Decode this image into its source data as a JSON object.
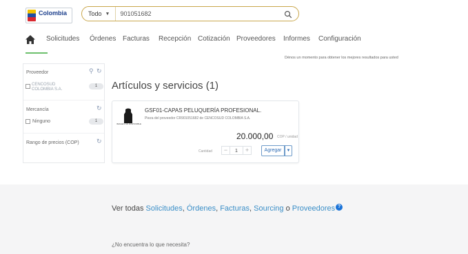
{
  "header": {
    "logo_text": "Colombia",
    "search_scope": "Todo",
    "search_value": "901051682"
  },
  "nav": {
    "items": [
      "Solicitudes",
      "Órdenes",
      "Facturas",
      "Recepción",
      "Cotización",
      "Proveedores",
      "Informes",
      "Configuración"
    ]
  },
  "status_message": "Dénos un momento para obtener los mejores resultados para usted",
  "filters": {
    "supplier": {
      "label": "Proveedor",
      "option": "CENCOSUD COLOMBIA S.A.",
      "count": "1"
    },
    "merchandise": {
      "label": "Mercancía",
      "option": "Ninguno",
      "count": "1"
    },
    "price_range": {
      "label": "Rango de precios (COP)"
    }
  },
  "results": {
    "title": "Artículos y servicios (1)",
    "item": {
      "thumbnail_caption": "IMAGEN NO DISPONIBLE",
      "title": "GSF01-CAPAS PELUQUERÍA PROFESIONAL.",
      "subtitle": "Pieza del proveedor CR901051682 de CENCOSUD COLOMBIA S.A.",
      "price": "20.000,00",
      "price_unit": "COP / unidad",
      "quantity_label": "Cantidad",
      "quantity": "1",
      "add_label": "Agregar"
    }
  },
  "footer": {
    "see_all_prefix": "Ver todas",
    "links": [
      "Solicitudes",
      "Órdenes",
      "Facturas",
      "Sourcing",
      "Proveedores"
    ],
    "conjunction": "o",
    "not_found": "¿No encuentra lo que necesita?"
  },
  "colors": {
    "link": "#3a8ec7",
    "accent_green": "#6cbf6c",
    "search_border": "#c9a64a",
    "info_blue": "#1a73d8"
  }
}
